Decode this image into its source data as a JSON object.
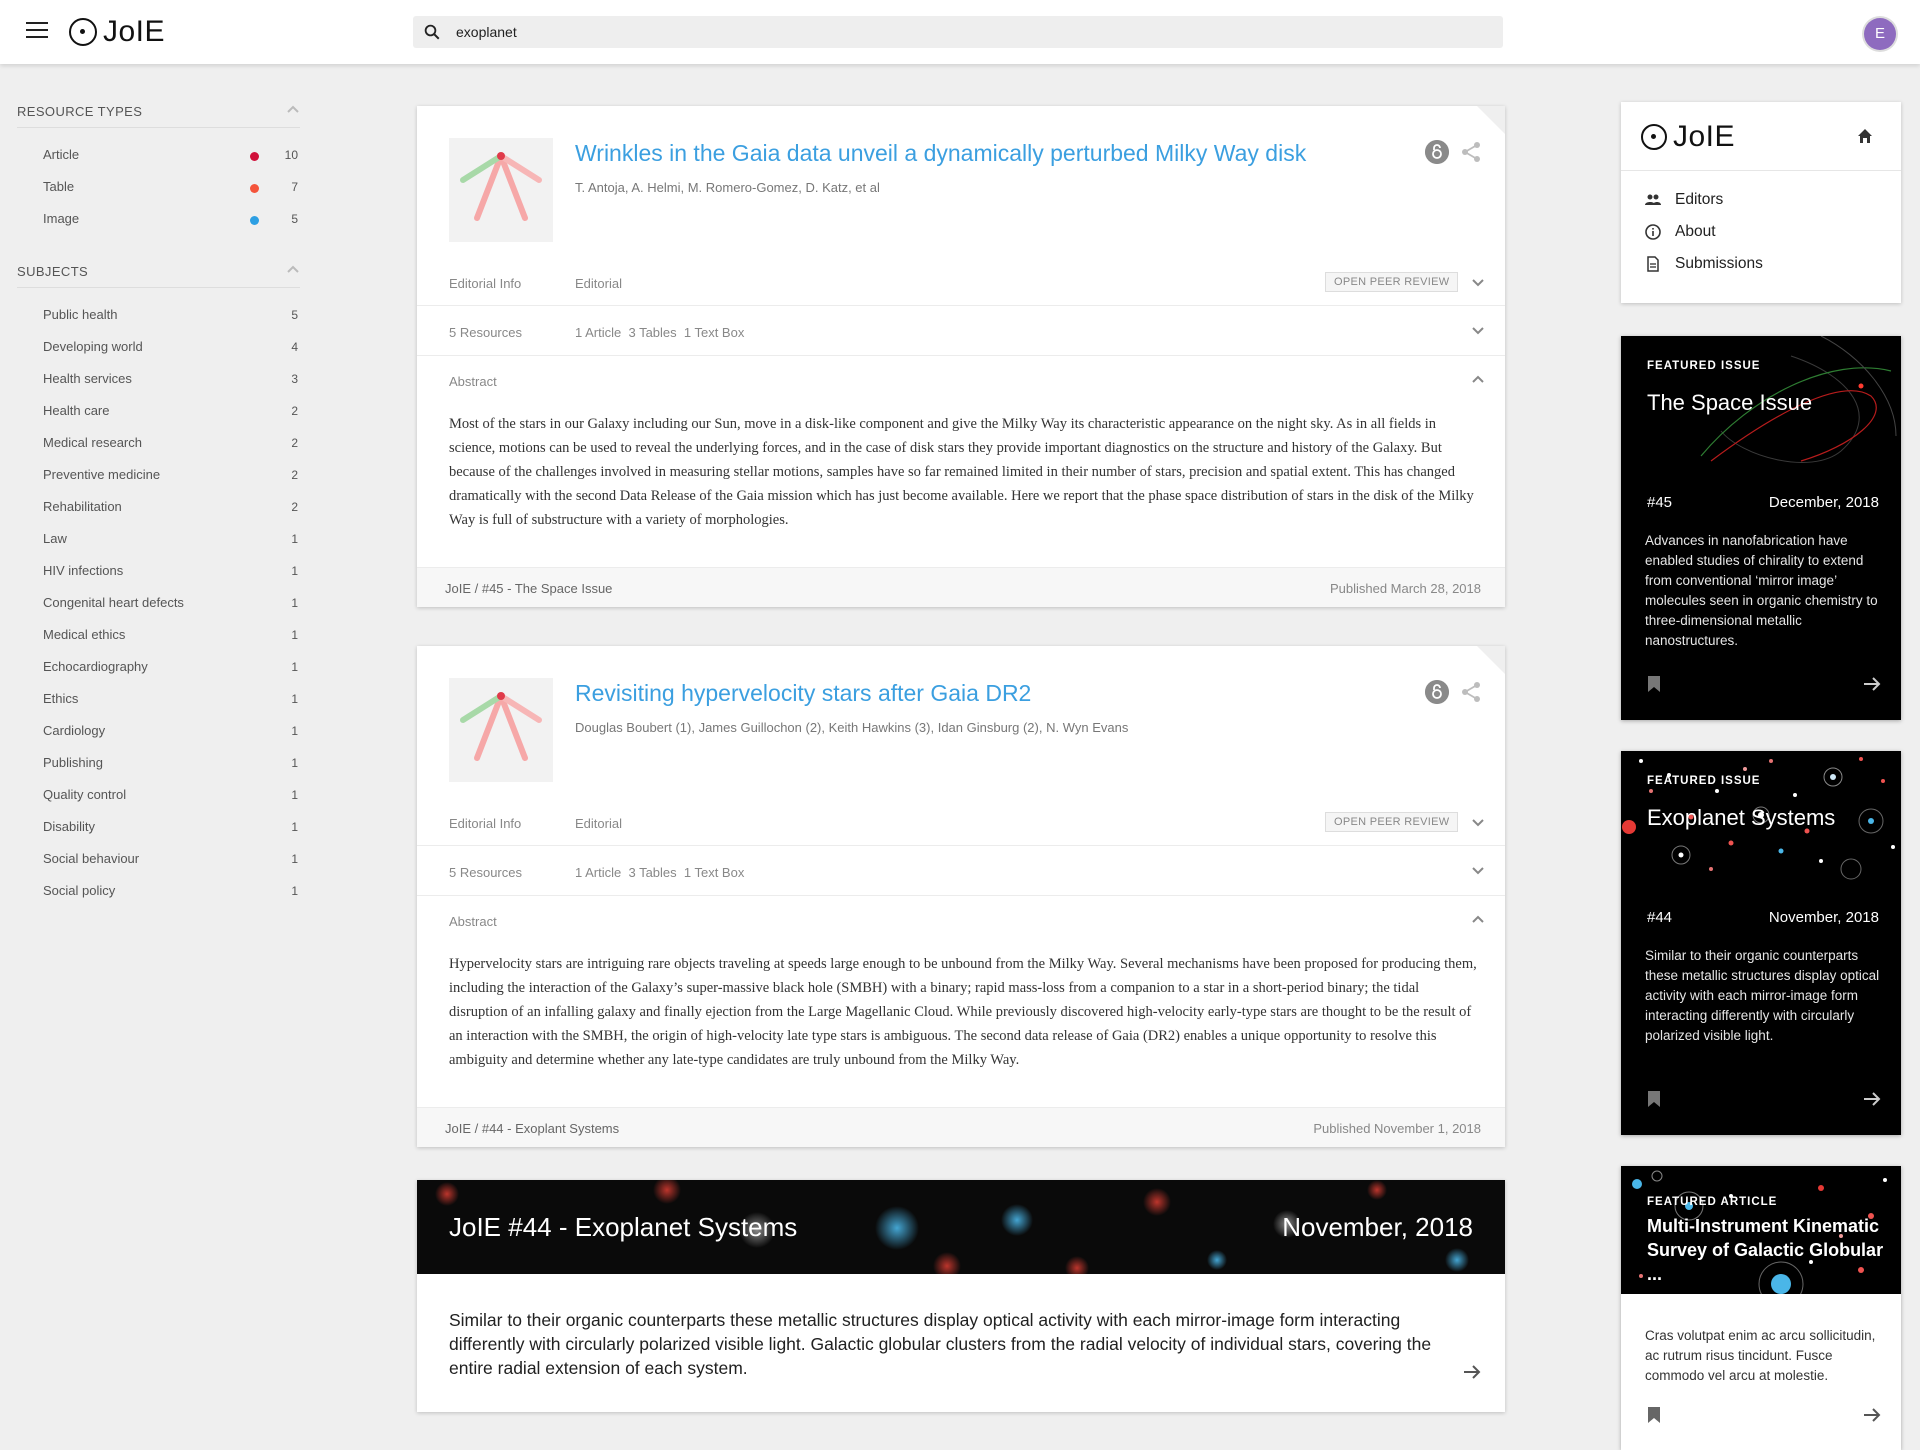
{
  "app": {
    "logo_text": "JoIE"
  },
  "search": {
    "value": "exoplanet",
    "placeholder": ""
  },
  "user": {
    "avatar_initial": "E",
    "avatar_color": "#8e6bbf"
  },
  "colors": {
    "link": "#3b9fe0",
    "article_dot": "#d0103a",
    "table_dot": "#f4543b",
    "image_dot": "#2d9fe3"
  },
  "sidebar": {
    "resource_types": {
      "label": "RESOURCE TYPES",
      "items": [
        {
          "label": "Article",
          "count": "10",
          "color": "#d0103a"
        },
        {
          "label": "Table",
          "count": "7",
          "color": "#f4543b"
        },
        {
          "label": "Image",
          "count": "5",
          "color": "#2d9fe3"
        }
      ]
    },
    "subjects": {
      "label": "SUBJECTS",
      "items": [
        {
          "label": "Public health",
          "count": "5"
        },
        {
          "label": "Developing world",
          "count": "4"
        },
        {
          "label": "Health services",
          "count": "3"
        },
        {
          "label": "Health care",
          "count": "2"
        },
        {
          "label": "Medical research",
          "count": "2"
        },
        {
          "label": "Preventive medicine",
          "count": "2"
        },
        {
          "label": "Rehabilitation",
          "count": "2"
        },
        {
          "label": "Law",
          "count": "1"
        },
        {
          "label": "HIV infections",
          "count": "1"
        },
        {
          "label": "Congenital heart defects",
          "count": "1"
        },
        {
          "label": "Medical ethics",
          "count": "1"
        },
        {
          "label": "Echocardiography",
          "count": "1"
        },
        {
          "label": "Ethics",
          "count": "1"
        },
        {
          "label": "Cardiology",
          "count": "1"
        },
        {
          "label": "Publishing",
          "count": "1"
        },
        {
          "label": "Quality control",
          "count": "1"
        },
        {
          "label": "Disability",
          "count": "1"
        },
        {
          "label": "Social behaviour",
          "count": "1"
        },
        {
          "label": "Social policy",
          "count": "1"
        }
      ]
    }
  },
  "articles": [
    {
      "title": "Wrinkles in the Gaia data unveil a dynamically perturbed Milky Way disk",
      "authors": "T. Antoja, A. Helmi, M. Romero-Gomez, D. Katz, et al",
      "editorial_label": "Editorial Info",
      "editorial_value": "Editorial",
      "peer_review": "OPEN PEER REVIEW",
      "resources_label": "5 Resources",
      "resources_value": "1 Article  3 Tables  1 Text Box",
      "abstract_label": "Abstract",
      "abstract": "Most of the stars in our Galaxy including our Sun, move in a disk-like component and give the Milky Way its characteristic appearance on the night sky. As in all fields in science, motions can be used to reveal the underlying forces, and in the case of disk stars they provide important diagnostics on the structure and history of the Galaxy. But because of the challenges involved in measuring stellar motions, samples have so far remained limited in their number of stars, precision and spatial extent. This has changed dramatically with the second Data Release of the Gaia mission which has just become available. Here we report that the phase space distribution of stars in the disk of the Milky Way is full of substructure with a variety of morphologies.",
      "breadcrumb": "JoIE / #45 - The Space Issue",
      "published": "Published March 28, 2018"
    },
    {
      "title": "Revisiting hypervelocity stars after Gaia DR2",
      "authors": "Douglas Boubert (1), James Guillochon (2), Keith Hawkins (3), Idan Ginsburg (2), N. Wyn Evans",
      "editorial_label": "Editorial Info",
      "editorial_value": "Editorial",
      "peer_review": "OPEN PEER REVIEW",
      "resources_label": "5 Resources",
      "resources_value": "1 Article  3 Tables  1 Text Box",
      "abstract_label": "Abstract",
      "abstract": "Hypervelocity stars are intriguing rare objects traveling at speeds large enough to be unbound from the Milky Way. Several mechanisms have been proposed for producing them, including the interaction of the Galaxy’s super-massive black hole (SMBH) with a binary; rapid mass-loss from a companion to a star in a short-period binary; the tidal disruption of an infalling galaxy and finally ejection from the Large Magellanic Cloud. While previously discovered high-velocity early-type stars are thought to be the result of an interaction with the SMBH, the origin of high-velocity late type stars is ambiguous. The second data release of Gaia (DR2) enables a unique opportunity to resolve this ambiguity and determine whether any late-type candidates are truly unbound from the Milky Way.",
      "breadcrumb": "JoIE / #44 - Exoplant Systems",
      "published": "Published November 1, 2018"
    }
  ],
  "issue_card": {
    "title": "JoIE #44 - Exoplanet Systems",
    "date": "November, 2018",
    "description": "Similar to their organic counterparts these metallic structures display optical activity with each mirror-image form interacting differently with circularly polarized visible light. Galactic globular clusters from the radial velocity of individual stars, covering the entire radial extension of each system."
  },
  "journal_card": {
    "logo_text": "JoIE",
    "links": [
      {
        "label": "Editors",
        "icon": "people-icon"
      },
      {
        "label": "About",
        "icon": "info-icon"
      },
      {
        "label": "Submissions",
        "icon": "document-icon"
      }
    ]
  },
  "featured": [
    {
      "kicker": "FEATURED ISSUE",
      "title": "The Space Issue",
      "number": "#45",
      "date": "December, 2018",
      "description": "Advances in nanofabrication have enabled studies of chirality to extend from conventional ‘mirror image’ molecules seen in organic chemistry to three-dimensional metallic nanostructures."
    },
    {
      "kicker": "FEATURED ISSUE",
      "title": "Exoplanet Systems",
      "number": "#44",
      "date": "November, 2018",
      "description": "Similar to their organic counterparts these metallic structures display optical activity with each mirror-image form interacting differently with circularly polarized visible light."
    },
    {
      "kicker": "FEATURED ARTICLE",
      "title": "Multi-Instrument Kinematic Survey of Galactic Globular ...",
      "description": "Cras volutpat enim ac arcu sollicitudin, ac rutrum risus tincidunt. Fusce commodo vel arcu at molestie."
    }
  ]
}
